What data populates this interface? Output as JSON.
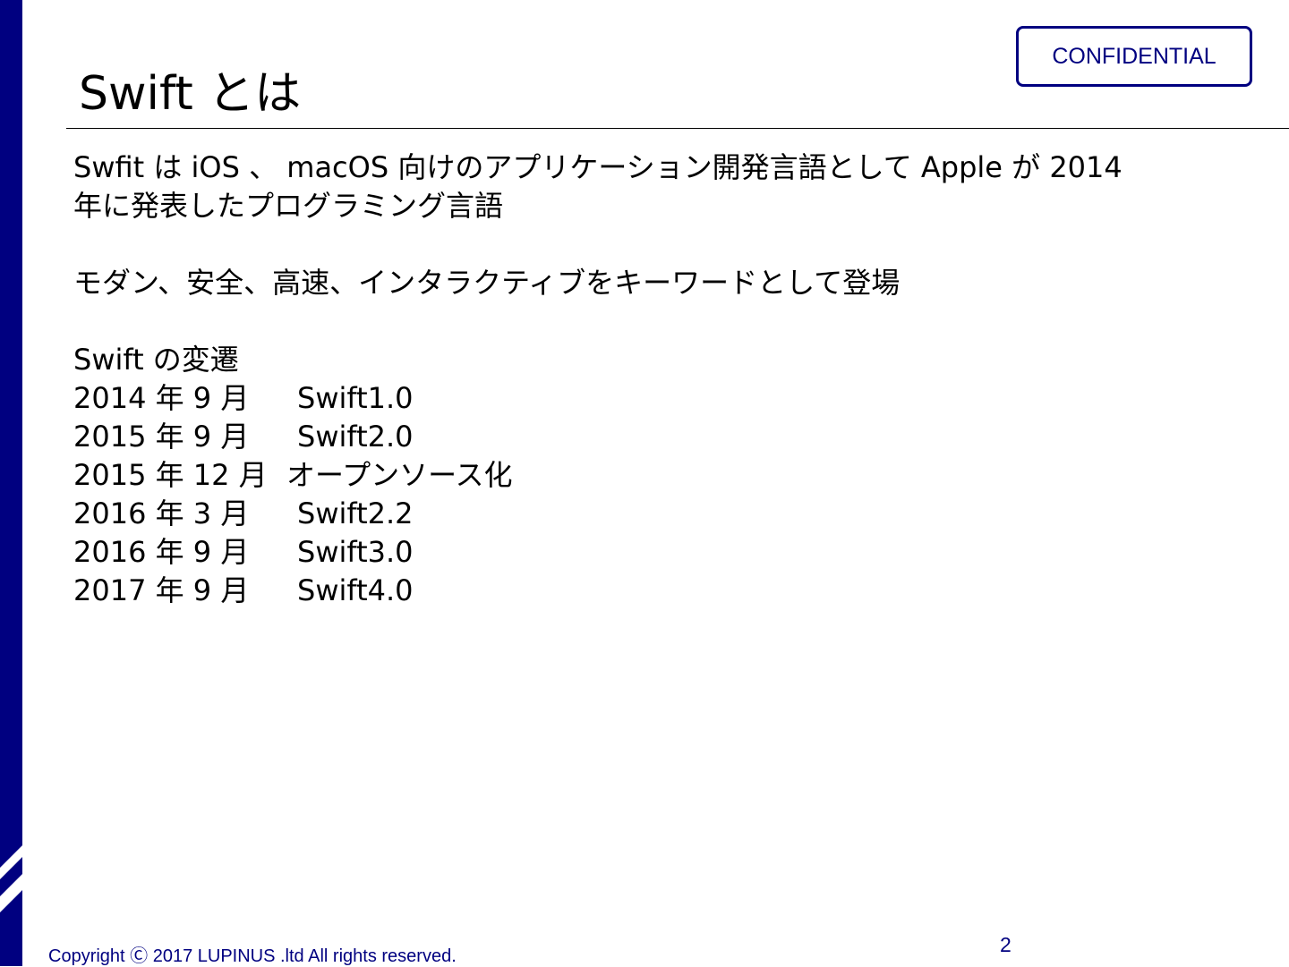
{
  "slide": {
    "badge": "CONFIDENTIAL",
    "title": "Swift とは",
    "intro_line1": "Swfit は iOS 、 macOS 向けのアプリケーション開発言語として Apple が 2014",
    "intro_line2": "年に発表したプログラミング言語",
    "keywords_line": "モダン、安全、高速、インタラクティブをキーワードとして登場",
    "history_heading": "Swift の変遷",
    "history": [
      {
        "date": "2014 年 9 月",
        "event": "Swift1.0"
      },
      {
        "date": "2015 年 9 月",
        "event": "Swift2.0"
      },
      {
        "date": "2015 年 12 月",
        "event": "オープンソース化"
      },
      {
        "date": "2016 年 3 月",
        "event": "Swift2.2"
      },
      {
        "date": "2016 年 9 月",
        "event": "Swift3.0"
      },
      {
        "date": "2017 年 9 月",
        "event": "Swift4.0"
      }
    ],
    "footer": {
      "copyright": "Copyright Ⓒ 2017 LUPINUS .ltd All rights reserved.",
      "page_number": "2"
    }
  },
  "colors": {
    "accent": "#000080",
    "text": "#000000",
    "background": "#ffffff"
  }
}
